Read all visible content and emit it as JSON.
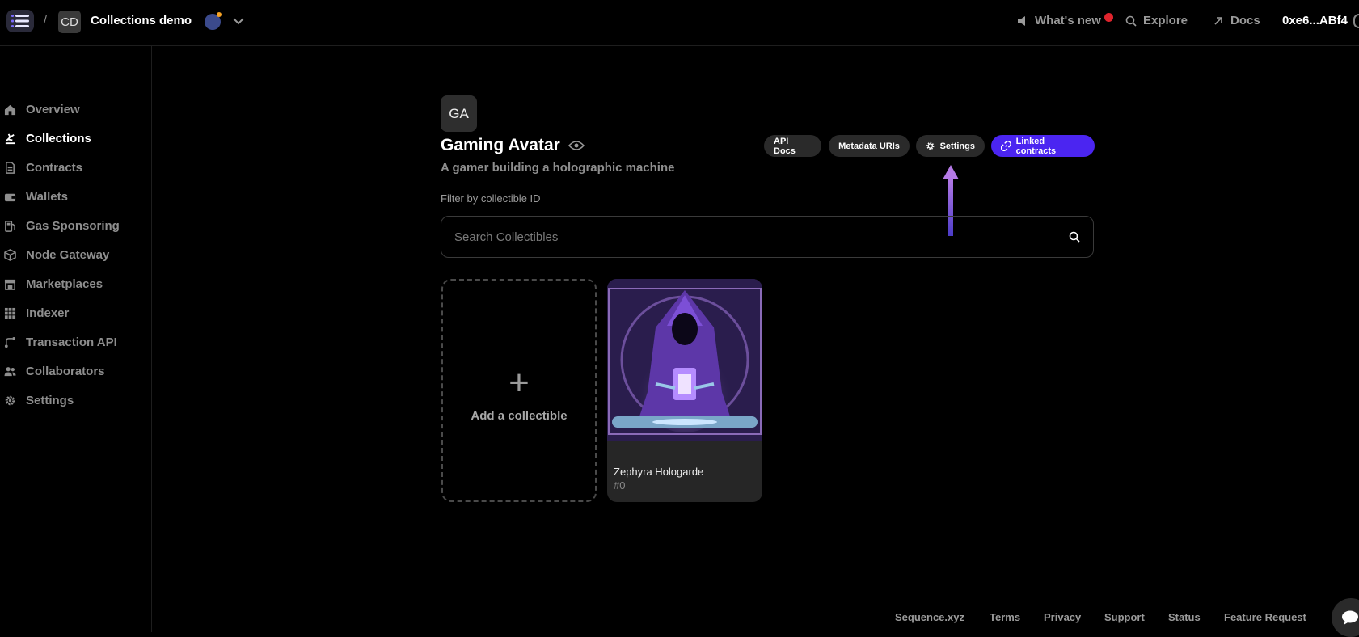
{
  "topbar": {
    "separator": "/",
    "project_initials": "CD",
    "project_name": "Collections demo",
    "whats_new": "What's new",
    "explore": "Explore",
    "docs": "Docs",
    "wallet": "0xe6...ABf4"
  },
  "sidebar": {
    "items": [
      {
        "label": "Overview",
        "icon": "home-icon"
      },
      {
        "label": "Collections",
        "icon": "collections-icon",
        "active": true
      },
      {
        "label": "Contracts",
        "icon": "contracts-icon"
      },
      {
        "label": "Wallets",
        "icon": "wallet-icon"
      },
      {
        "label": "Gas Sponsoring",
        "icon": "gas-pump-icon"
      },
      {
        "label": "Node Gateway",
        "icon": "cube-icon"
      },
      {
        "label": "Marketplaces",
        "icon": "store-icon"
      },
      {
        "label": "Indexer",
        "icon": "grid-icon"
      },
      {
        "label": "Transaction API",
        "icon": "route-icon"
      },
      {
        "label": "Collaborators",
        "icon": "users-icon"
      },
      {
        "label": "Settings",
        "icon": "gear-icon"
      }
    ]
  },
  "collection": {
    "initials": "GA",
    "title": "Gaming Avatar",
    "description": "A gamer building a holographic machine",
    "buttons": {
      "api_docs": "API Docs",
      "metadata_uris": "Metadata URIs",
      "settings": "Settings",
      "linked_contracts": "Linked contracts"
    }
  },
  "filter": {
    "label": "Filter by collectible ID",
    "placeholder": "Search Collectibles"
  },
  "cards": {
    "add_label": "Add a collectible",
    "add_symbol": "+",
    "items": [
      {
        "name": "Zephyra Hologarde",
        "id": "#0"
      }
    ]
  },
  "footer": {
    "links": [
      "Sequence.xyz",
      "Terms",
      "Privacy",
      "Support",
      "Status",
      "Feature Request"
    ]
  },
  "colors": {
    "accent": "#4b25f1",
    "notification": "#e0242d",
    "arrow": "#8a5ad8"
  }
}
